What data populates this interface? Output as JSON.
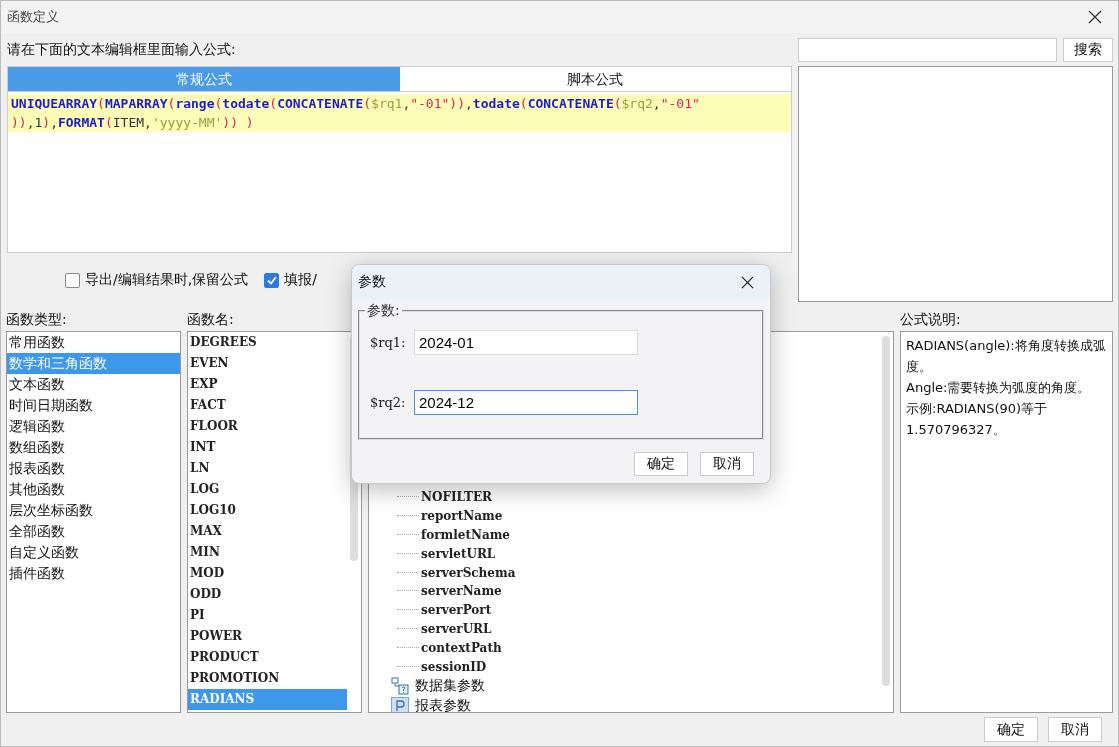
{
  "window": {
    "title": "函数定义"
  },
  "prompt": "请在下面的文本编辑框里面输入公式:",
  "tabs": [
    {
      "label": "常规公式",
      "selected": true
    },
    {
      "label": "脚本公式",
      "selected": false
    }
  ],
  "formula": {
    "lines": [
      [
        {
          "text": "UNIQUEARRAY",
          "kind": "fn"
        },
        {
          "text": "(",
          "kind": "paren"
        },
        {
          "text": "MAPARRAY",
          "kind": "fn"
        },
        {
          "text": "(",
          "kind": "paren"
        },
        {
          "text": "range",
          "kind": "fn"
        },
        {
          "text": "(",
          "kind": "paren"
        },
        {
          "text": "todate",
          "kind": "fn"
        },
        {
          "text": "(",
          "kind": "paren"
        },
        {
          "text": "CONCATENATE",
          "kind": "fn"
        },
        {
          "text": "(",
          "kind": "paren"
        },
        {
          "text": "$rq1",
          "kind": "var"
        },
        {
          "text": ",",
          "kind": "plain"
        },
        {
          "text": "\"-01\"",
          "kind": "str"
        },
        {
          "text": "))",
          "kind": "paren"
        },
        {
          "text": ",",
          "kind": "plain"
        },
        {
          "text": "todate",
          "kind": "fn"
        },
        {
          "text": "(",
          "kind": "paren"
        },
        {
          "text": "CONCATENATE",
          "kind": "fn"
        },
        {
          "text": "(",
          "kind": "paren"
        },
        {
          "text": "$rq2",
          "kind": "var"
        },
        {
          "text": ",",
          "kind": "plain"
        },
        {
          "text": "\"-01\"",
          "kind": "str"
        }
      ],
      [
        {
          "text": "))",
          "kind": "paren"
        },
        {
          "text": ",1",
          "kind": "plain"
        },
        {
          "text": ")",
          "kind": "paren"
        },
        {
          "text": ",",
          "kind": "plain"
        },
        {
          "text": "FORMAT",
          "kind": "fn"
        },
        {
          "text": "(",
          "kind": "paren"
        },
        {
          "text": "ITEM,",
          "kind": "plain"
        },
        {
          "text": "'yyyy-MM'",
          "kind": "var"
        },
        {
          "text": "))",
          "kind": "paren"
        },
        {
          "text": " )",
          "kind": "paren"
        }
      ]
    ]
  },
  "search": {
    "button": "搜索"
  },
  "options": [
    {
      "label": "导出/编辑结果时,保留公式",
      "checked": false
    },
    {
      "label": "填报/",
      "checked": true
    }
  ],
  "function_types": {
    "label": "函数类型:",
    "items": [
      {
        "label": "常用函数",
        "selected": false
      },
      {
        "label": "数学和三角函数",
        "selected": true
      },
      {
        "label": "文本函数",
        "selected": false
      },
      {
        "label": "时间日期函数",
        "selected": false
      },
      {
        "label": "逻辑函数",
        "selected": false
      },
      {
        "label": "数组函数",
        "selected": false
      },
      {
        "label": "报表函数",
        "selected": false
      },
      {
        "label": "其他函数",
        "selected": false
      },
      {
        "label": "层次坐标函数",
        "selected": false
      },
      {
        "label": "全部函数",
        "selected": false
      },
      {
        "label": "自定义函数",
        "selected": false
      },
      {
        "label": "插件函数",
        "selected": false
      }
    ]
  },
  "function_names": {
    "label": "函数名:",
    "items": [
      {
        "label": "DEGREES",
        "selected": false
      },
      {
        "label": "EVEN",
        "selected": false
      },
      {
        "label": "EXP",
        "selected": false
      },
      {
        "label": "FACT",
        "selected": false
      },
      {
        "label": "FLOOR",
        "selected": false
      },
      {
        "label": "INT",
        "selected": false
      },
      {
        "label": "LN",
        "selected": false
      },
      {
        "label": "LOG",
        "selected": false
      },
      {
        "label": "LOG10",
        "selected": false
      },
      {
        "label": "MAX",
        "selected": false
      },
      {
        "label": "MIN",
        "selected": false
      },
      {
        "label": "MOD",
        "selected": false
      },
      {
        "label": "ODD",
        "selected": false
      },
      {
        "label": "PI",
        "selected": false
      },
      {
        "label": "POWER",
        "selected": false
      },
      {
        "label": "PRODUCT",
        "selected": false
      },
      {
        "label": "PROMOTION",
        "selected": false
      },
      {
        "label": "RADIANS",
        "selected": true
      }
    ]
  },
  "tree": {
    "items": [
      {
        "label": "NOFILTER",
        "kind": "leaf"
      },
      {
        "label": "reportName",
        "kind": "leaf"
      },
      {
        "label": "formletName",
        "kind": "leaf"
      },
      {
        "label": "servletURL",
        "kind": "leaf"
      },
      {
        "label": "serverSchema",
        "kind": "leaf"
      },
      {
        "label": "serverName",
        "kind": "leaf"
      },
      {
        "label": "serverPort",
        "kind": "leaf"
      },
      {
        "label": "serverURL",
        "kind": "leaf"
      },
      {
        "label": "contextPath",
        "kind": "leaf"
      },
      {
        "label": "sessionID",
        "kind": "leaf"
      },
      {
        "label": "数据集参数",
        "kind": "dataset"
      },
      {
        "label": "报表参数",
        "kind": "param"
      }
    ]
  },
  "description": {
    "label": "公式说明:",
    "paragraphs": [
      "RADIANS(angle):将角度转换成弧度。",
      "Angle:需要转换为弧度的角度。",
      "示例:RADIANS(90)等于1.570796327。"
    ]
  },
  "buttons": [
    "确定",
    "取消"
  ],
  "dialog": {
    "title": "参数",
    "group": "参数:",
    "fields": [
      {
        "label": "$rq1:",
        "value": "2024-01",
        "focused": false
      },
      {
        "label": "$rq2:",
        "value": "2024-12",
        "focused": true
      }
    ],
    "buttons": [
      "确定",
      "取消"
    ]
  }
}
